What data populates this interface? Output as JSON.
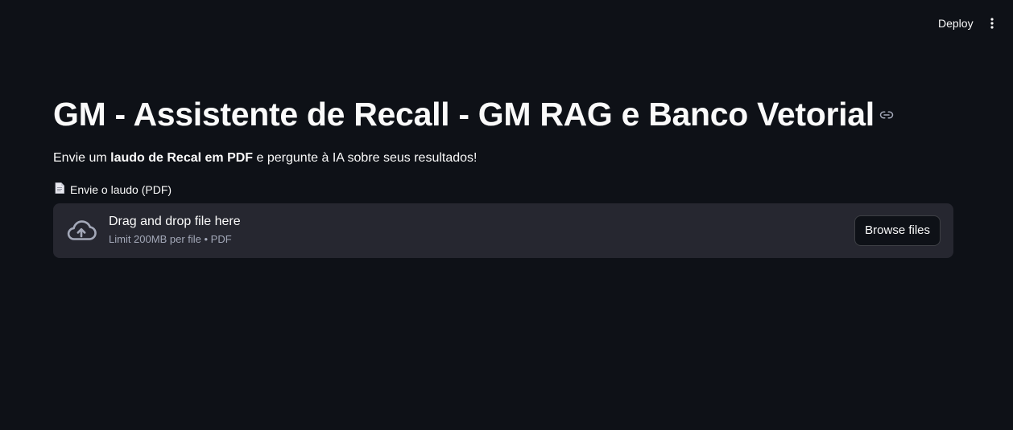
{
  "toolbar": {
    "deploy_label": "Deploy",
    "menu_icon": "more-vertical-icon"
  },
  "header": {
    "title": "GM - Assistente de Recall - GM RAG e Banco Vetorial",
    "anchor_icon": "link-icon"
  },
  "intro": {
    "prefix": "Envie um ",
    "bold": "laudo de Recal em PDF",
    "suffix": " e pergunte à IA sobre seus resultados!"
  },
  "uploader": {
    "label_icon": "document-icon",
    "label": "Envie o laudo (PDF)",
    "upload_icon": "cloud-upload-icon",
    "instruction": "Drag and drop file here",
    "limit": "Limit 200MB per file • PDF",
    "browse_label": "Browse files"
  },
  "colors": {
    "background": "#0e1117",
    "dropzone": "#262730",
    "text": "#fafafa",
    "muted_text": "#a3a8b8"
  }
}
